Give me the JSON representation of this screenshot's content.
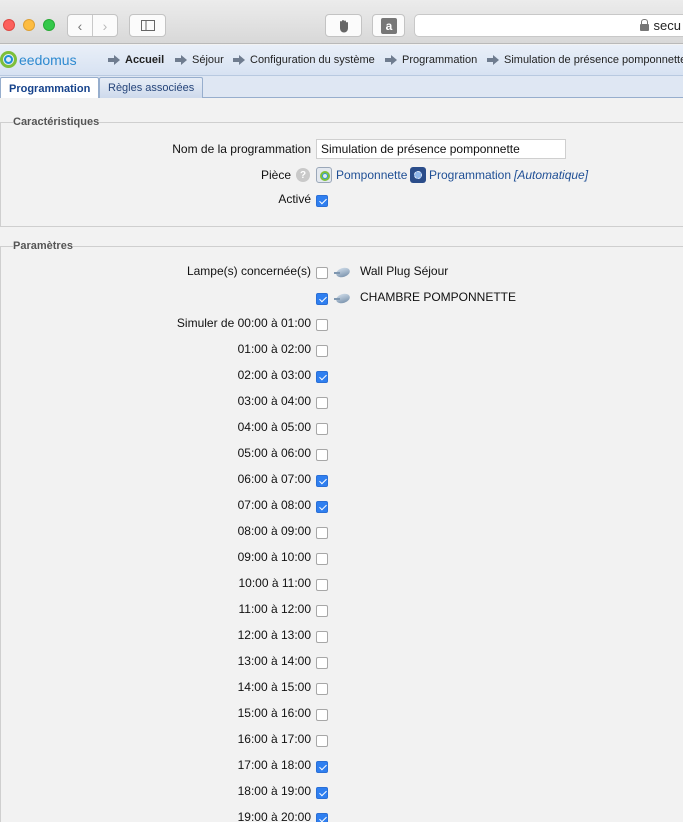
{
  "browser": {
    "url_text": "secu"
  },
  "header": {
    "logo": "eedomus",
    "breadcrumb": [
      "Accueil",
      "Séjour",
      "Configuration du système",
      "Programmation",
      "Simulation de présence pomponnette"
    ]
  },
  "tabs": [
    {
      "label": "Programmation",
      "active": true
    },
    {
      "label": "Règles associées",
      "active": false
    }
  ],
  "caracteristiques": {
    "legend": "Caractéristiques",
    "name_label": "Nom de la programmation",
    "name_value": "Simulation de présence pomponnette",
    "piece_label": "Pièce",
    "piece_room": "Pomponnette",
    "piece_type": "Programmation",
    "piece_mode": "[Automatique]",
    "active_label": "Activé",
    "active_checked": true
  },
  "parametres": {
    "legend": "Paramètres",
    "lamps_label": "Lampe(s) concernée(s)",
    "lamps": [
      {
        "name": "Wall Plug Séjour",
        "checked": false
      },
      {
        "name": "CHAMBRE POMPONNETTE",
        "checked": true
      }
    ],
    "slots_first_label": "Simuler de 00:00 à 01:00",
    "slots": [
      {
        "label": "Simuler de 00:00 à 01:00",
        "checked": false
      },
      {
        "label": "01:00 à 02:00",
        "checked": false
      },
      {
        "label": "02:00 à 03:00",
        "checked": true
      },
      {
        "label": "03:00 à 04:00",
        "checked": false
      },
      {
        "label": "04:00 à 05:00",
        "checked": false
      },
      {
        "label": "05:00 à 06:00",
        "checked": false
      },
      {
        "label": "06:00 à 07:00",
        "checked": true
      },
      {
        "label": "07:00 à 08:00",
        "checked": true
      },
      {
        "label": "08:00 à 09:00",
        "checked": false
      },
      {
        "label": "09:00 à 10:00",
        "checked": false
      },
      {
        "label": "10:00 à 11:00",
        "checked": false
      },
      {
        "label": "11:00 à 12:00",
        "checked": false
      },
      {
        "label": "12:00 à 13:00",
        "checked": false
      },
      {
        "label": "13:00 à 14:00",
        "checked": false
      },
      {
        "label": "14:00 à 15:00",
        "checked": false
      },
      {
        "label": "15:00 à 16:00",
        "checked": false
      },
      {
        "label": "16:00 à 17:00",
        "checked": false
      },
      {
        "label": "17:00 à 18:00",
        "checked": true
      },
      {
        "label": "18:00 à 19:00",
        "checked": true
      },
      {
        "label": "19:00 à 20:00",
        "checked": true
      }
    ]
  }
}
